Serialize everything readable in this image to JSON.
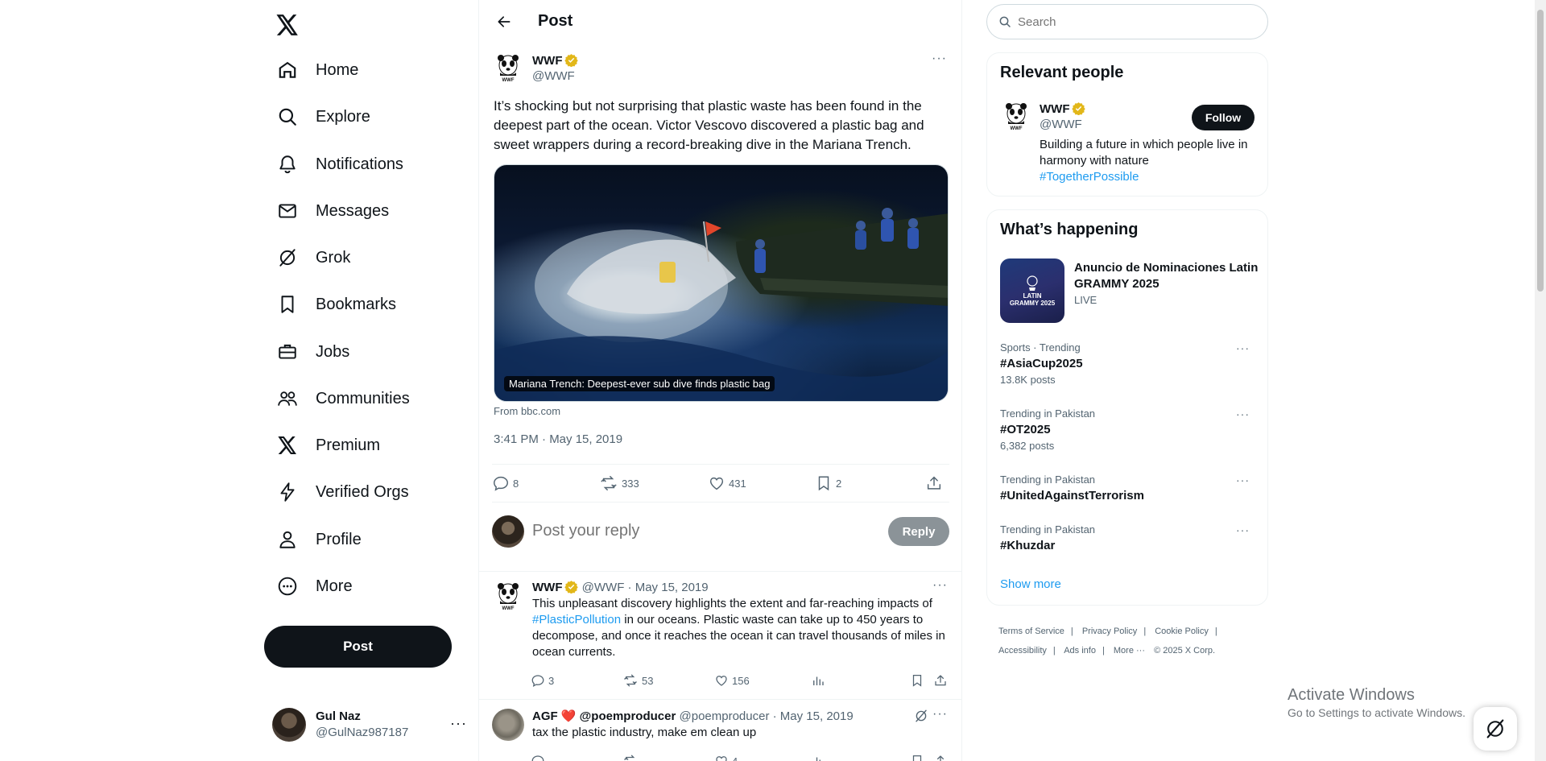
{
  "app": {
    "title": "Post",
    "logo": "x-logo-icon"
  },
  "nav": {
    "items": [
      {
        "label": "Home",
        "icon": "home-icon"
      },
      {
        "label": "Explore",
        "icon": "search-icon"
      },
      {
        "label": "Notifications",
        "icon": "bell-icon"
      },
      {
        "label": "Messages",
        "icon": "envelope-icon"
      },
      {
        "label": "Grok",
        "icon": "grok-icon"
      },
      {
        "label": "Bookmarks",
        "icon": "bookmark-icon"
      },
      {
        "label": "Jobs",
        "icon": "briefcase-icon"
      },
      {
        "label": "Communities",
        "icon": "people-icon"
      },
      {
        "label": "Premium",
        "icon": "x-logo-icon"
      },
      {
        "label": "Verified Orgs",
        "icon": "lightning-icon"
      },
      {
        "label": "Profile",
        "icon": "person-icon"
      },
      {
        "label": "More",
        "icon": "more-circle-icon"
      }
    ],
    "post_button": "Post",
    "account": {
      "name": "Gul Naz",
      "handle": "@GulNaz987187"
    }
  },
  "main": {
    "header_title": "Post",
    "post": {
      "author_name": "WWF",
      "author_handle": "@WWF",
      "text": "It’s shocking but not surprising that plastic waste has been found in the deepest part of the ocean. Victor Vescovo discovered a plastic bag and sweet wrappers during a record-breaking dive in the Mariana Trench.",
      "card_caption": "Mariana Trench: Deepest-ever sub dive finds plastic bag",
      "card_source": "From bbc.com",
      "timestamp": "3:41 PM · May 15, 2019",
      "stats": {
        "replies": "8",
        "reposts": "333",
        "likes": "431",
        "bookmarks": "2"
      }
    },
    "reply": {
      "placeholder": "Post your reply",
      "button": "Reply"
    },
    "thread": [
      {
        "name": "WWF",
        "handle": "@WWF",
        "date": "May 15, 2019",
        "text_before": "This unpleasant discovery highlights the extent and far-reaching impacts of ",
        "hashtag": "#PlasticPollution",
        "text_after": " in our oceans. Plastic waste can take up to 450 years to decompose, and once it reaches the ocean it can travel thousands of miles in ocean currents.",
        "replies": "3",
        "reposts": "53",
        "likes": "156"
      },
      {
        "name": "AGF ❤️ @poemproducer",
        "handle": "@poemproducer",
        "date": "May 15, 2019",
        "text": "tax the plastic industry, make em clean up",
        "likes": "4"
      }
    ]
  },
  "sidebar": {
    "search_placeholder": "Search",
    "relevant_people": {
      "title": "Relevant people",
      "name": "WWF",
      "handle": "@WWF",
      "bio": "Building a future in which people live in harmony with nature",
      "bio_hashtag": "#TogetherPossible",
      "follow": "Follow"
    },
    "happening": {
      "title": "What’s happening",
      "event": {
        "title": "Anuncio de Nominaciones Latin GRAMMY 2025",
        "status": "LIVE",
        "thumb_text": "LATIN GRAMMY 2025"
      },
      "trends": [
        {
          "context": "Sports · Trending",
          "name": "#AsiaCup2025",
          "count": "13.8K posts"
        },
        {
          "context": "Trending in Pakistan",
          "name": "#OT2025",
          "count": "6,382 posts"
        },
        {
          "context": "Trending in Pakistan",
          "name": "#UnitedAgainstTerrorism",
          "count": ""
        },
        {
          "context": "Trending in Pakistan",
          "name": "#Khuzdar",
          "count": ""
        }
      ],
      "show_more": "Show more"
    },
    "footer": {
      "links": [
        "Terms of Service",
        "Privacy Policy",
        "Cookie Policy",
        "Accessibility",
        "Ads info",
        "More ···"
      ],
      "copyright": "© 2025 X Corp."
    }
  },
  "windows": {
    "activate_title": "Activate Windows",
    "activate_sub": "Go to Settings to activate Windows."
  },
  "colors": {
    "accent": "#1d9bf0",
    "text": "#0f1419",
    "muted": "#536471",
    "gold_badge": "#e2b719"
  }
}
